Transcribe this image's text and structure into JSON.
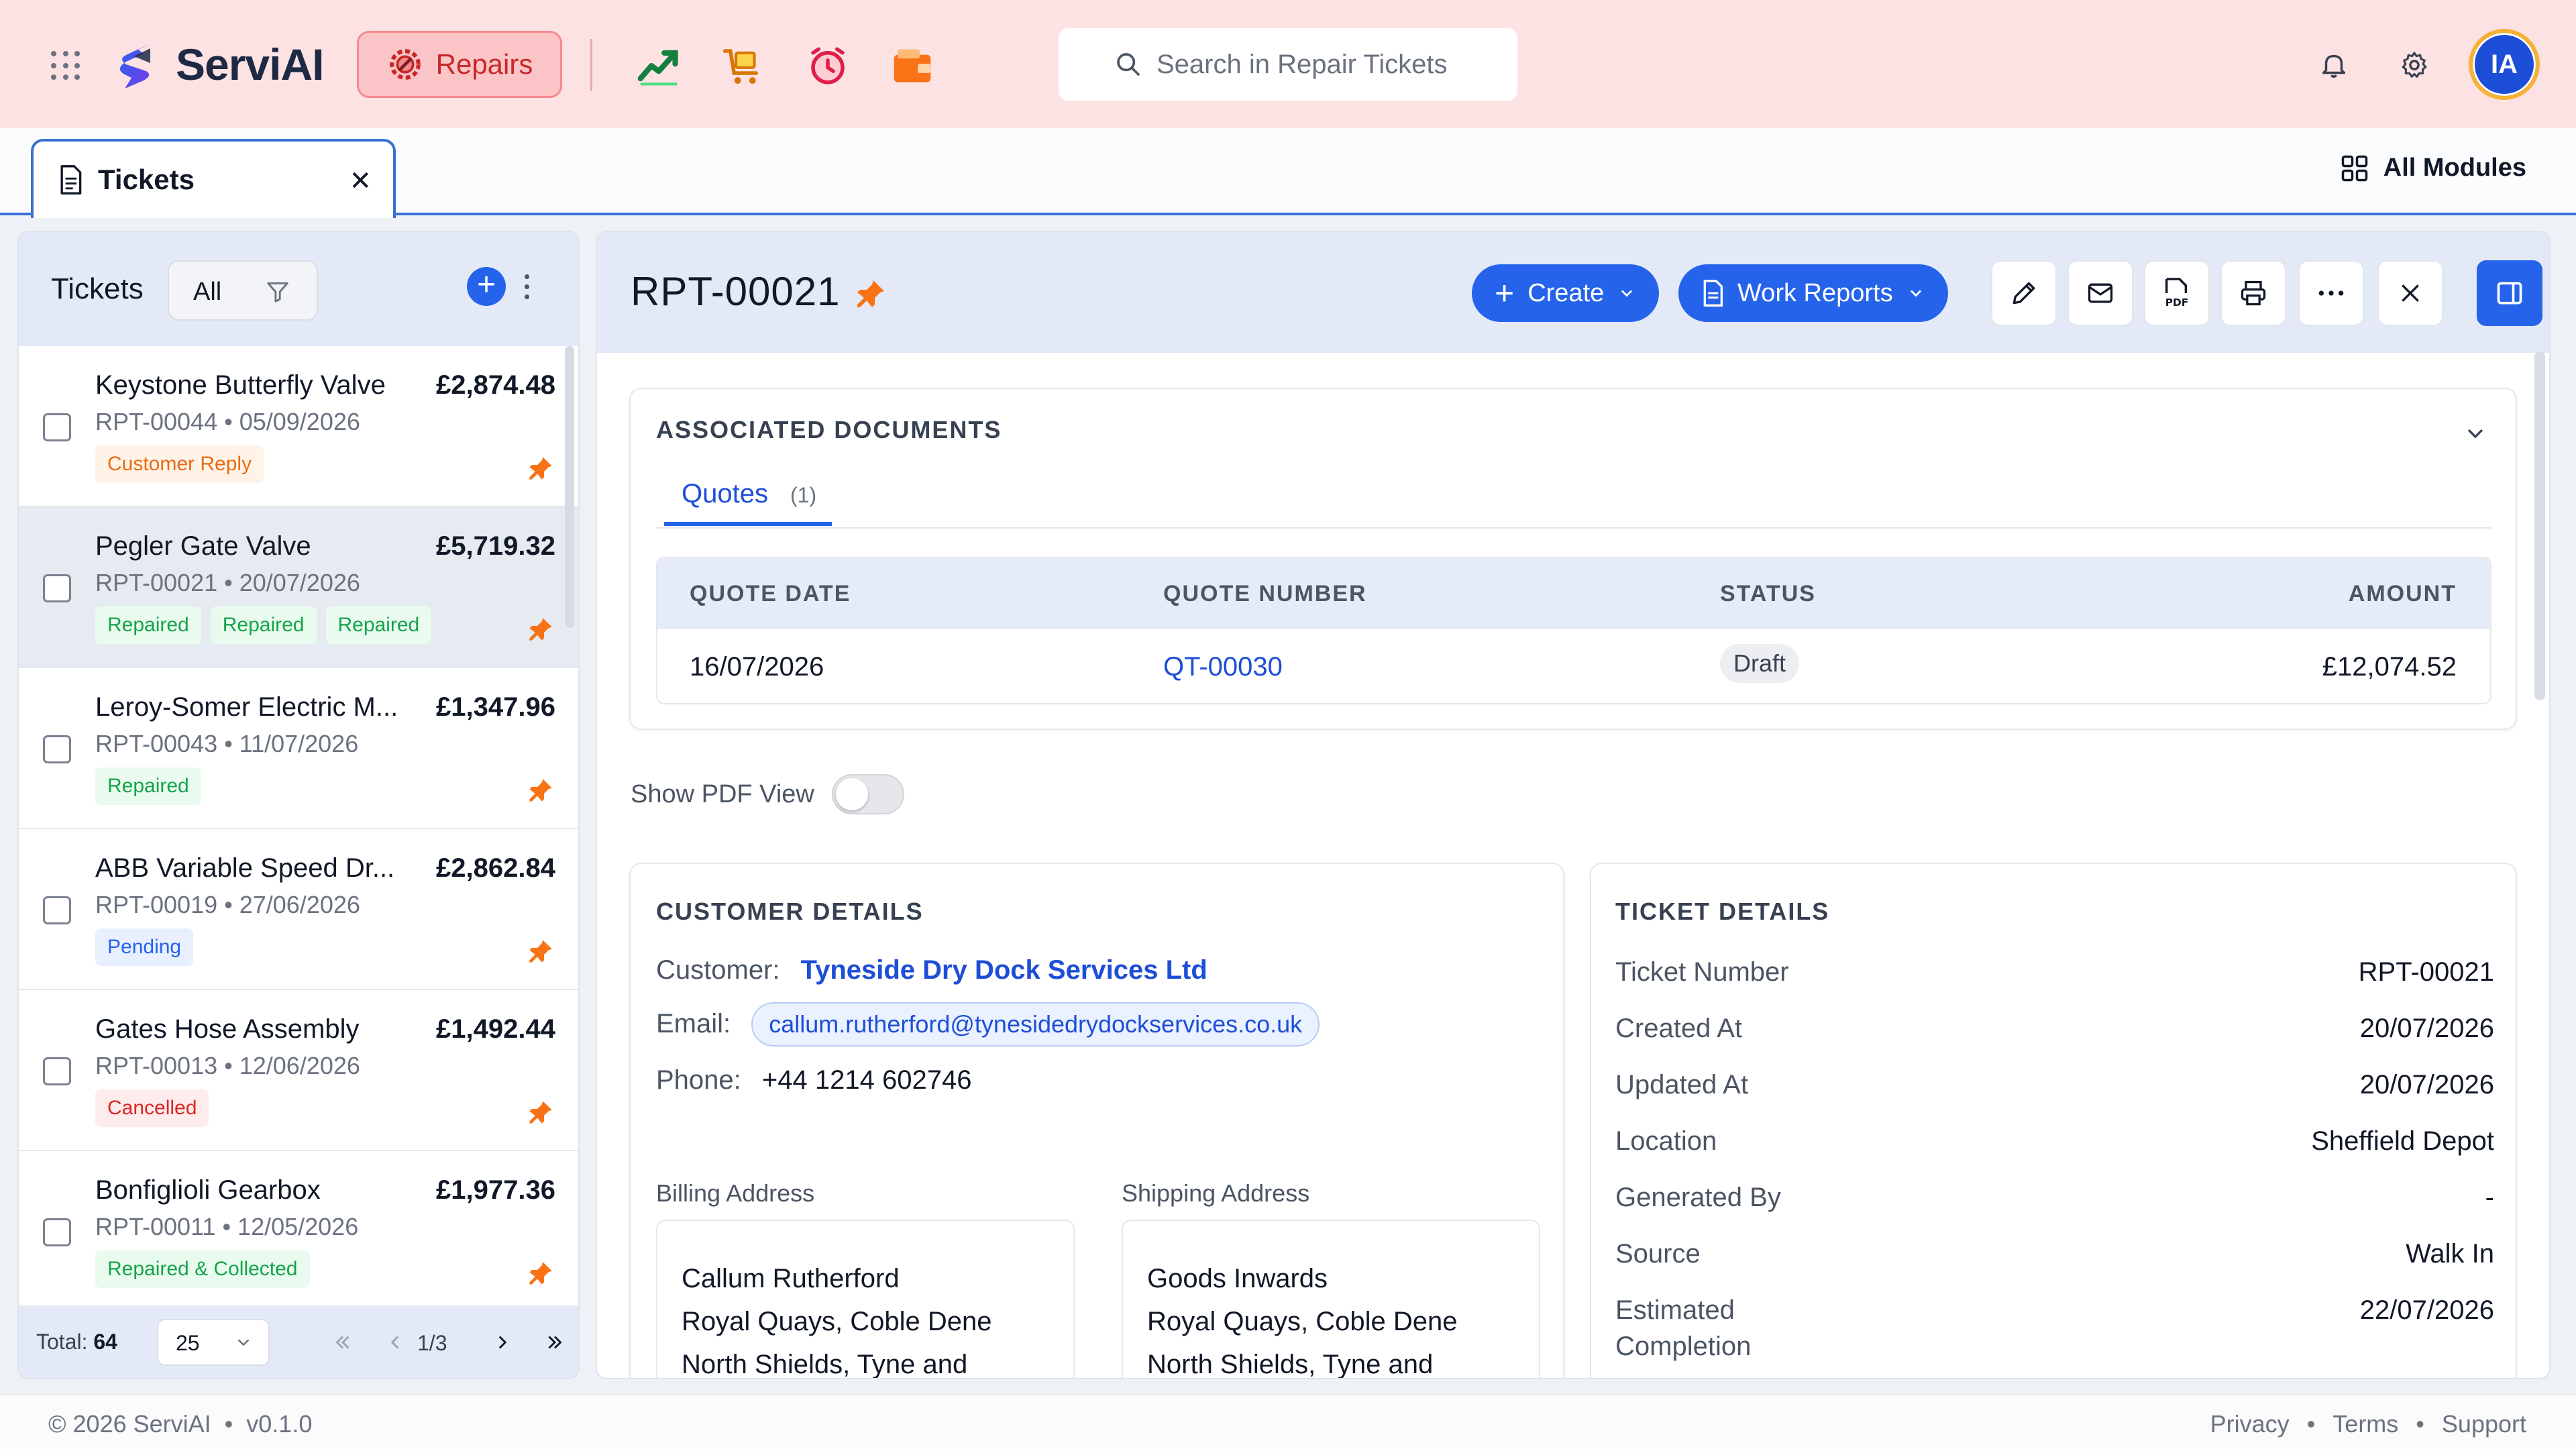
{
  "app": {
    "name": "ServiAI",
    "module_label": "Repairs",
    "search_placeholder": "Search in Repair Tickets",
    "user_initials": "IA",
    "colors": {
      "accent": "#2563eb",
      "topbar": "#fde2e4",
      "module": "#c62828"
    }
  },
  "tabs": {
    "active_tab": "Tickets",
    "all_modules_label": "All Modules"
  },
  "list": {
    "title": "Tickets",
    "filter_label": "All",
    "items": [
      {
        "name": "Keystone Butterfly Valve",
        "amount": "£2,874.48",
        "meta": "RPT-00044 • 05/09/2026",
        "badges": [
          {
            "text": "Customer Reply",
            "color": "orange"
          }
        ],
        "pinned": true
      },
      {
        "name": "Pegler Gate Valve",
        "amount": "£5,719.32",
        "meta": "RPT-00021 • 20/07/2026",
        "badges": [
          {
            "text": "Repaired",
            "color": "green"
          },
          {
            "text": "Repaired",
            "color": "green"
          },
          {
            "text": "Repaired",
            "color": "green"
          }
        ],
        "pinned": true,
        "selected": true
      },
      {
        "name": "Leroy-Somer Electric M...",
        "amount": "£1,347.96",
        "meta": "RPT-00043 • 11/07/2026",
        "badges": [
          {
            "text": "Repaired",
            "color": "green"
          }
        ],
        "pinned": true
      },
      {
        "name": "ABB Variable Speed Dr...",
        "amount": "£2,862.84",
        "meta": "RPT-00019 • 27/06/2026",
        "badges": [
          {
            "text": "Pending",
            "color": "blue"
          }
        ],
        "pinned": true
      },
      {
        "name": "Gates Hose Assembly",
        "amount": "£1,492.44",
        "meta": "RPT-00013 • 12/06/2026",
        "badges": [
          {
            "text": "Cancelled",
            "color": "red"
          }
        ],
        "pinned": true
      },
      {
        "name": "Bonfiglioli Gearbox",
        "amount": "£1,977.36",
        "meta": "RPT-00011 • 12/05/2026",
        "badges": [
          {
            "text": "Repaired & Collected",
            "color": "green"
          }
        ],
        "pinned": true
      }
    ],
    "footer": {
      "total_label": "Total:",
      "total_value": "64",
      "page_size": "25",
      "page_indicator": "1/3"
    }
  },
  "detail": {
    "ticket_id": "RPT-00021",
    "create_label": "Create",
    "work_reports_label": "Work Reports",
    "associated": {
      "title": "ASSOCIATED DOCUMENTS",
      "tab_label": "Quotes",
      "tab_count": "(1)",
      "columns": [
        "QUOTE DATE",
        "QUOTE NUMBER",
        "STATUS",
        "AMOUNT"
      ],
      "row": {
        "date": "16/07/2026",
        "number": "QT-00030",
        "status": "Draft",
        "amount": "£12,074.52"
      }
    },
    "pdf_toggle_label": "Show PDF View",
    "customer": {
      "title": "CUSTOMER DETAILS",
      "customer_label": "Customer:",
      "customer_value": "Tyneside Dry Dock Services Ltd",
      "email_label": "Email:",
      "email_value": "callum.rutherford@tynesidedrydockservices.co.uk",
      "phone_label": "Phone:",
      "phone_value": "+44 1214 602746",
      "billing_label": "Billing Address",
      "shipping_label": "Shipping Address",
      "billing_lines": [
        "Callum Rutherford",
        "Royal Quays, Coble Dene",
        "North Shields, Tyne and"
      ],
      "shipping_lines": [
        "Goods Inwards",
        "Royal Quays, Coble Dene",
        "North Shields, Tyne and"
      ]
    },
    "ticket": {
      "title": "TICKET DETAILS",
      "rows": [
        {
          "label": "Ticket Number",
          "value": "RPT-00021"
        },
        {
          "label": "Created At",
          "value": "20/07/2026"
        },
        {
          "label": "Updated At",
          "value": "20/07/2026"
        },
        {
          "label": "Location",
          "value": "Sheffield Depot"
        },
        {
          "label": "Generated By",
          "value": "-"
        },
        {
          "label": "Source",
          "value": "Walk In"
        },
        {
          "label": "Estimated Completion",
          "value": "22/07/2026"
        }
      ]
    }
  },
  "footer": {
    "copyright": "© 2026 ServiAI",
    "version": "v0.1.0",
    "links": [
      "Privacy",
      "Terms",
      "Support"
    ]
  }
}
